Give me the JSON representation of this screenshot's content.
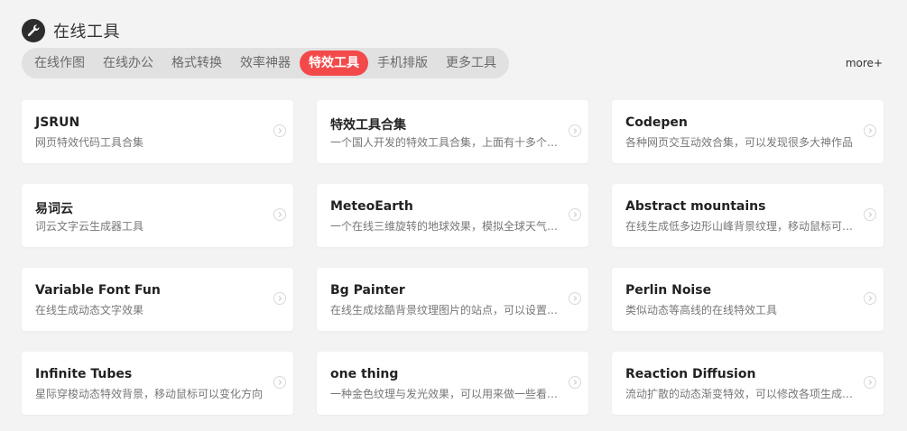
{
  "section": {
    "icon": "wrench-icon",
    "title": "在线工具"
  },
  "tabs": [
    {
      "label": "在线作图",
      "active": false
    },
    {
      "label": "在线办公",
      "active": false
    },
    {
      "label": "格式转换",
      "active": false
    },
    {
      "label": "效率神器",
      "active": false
    },
    {
      "label": "特效工具",
      "active": true
    },
    {
      "label": "手机排版",
      "active": false
    },
    {
      "label": "更多工具",
      "active": false
    }
  ],
  "more_label": "more+",
  "colors": {
    "accent": "#f4494a",
    "background": "#f3f3f4",
    "card": "#ffffff"
  },
  "cards": [
    {
      "title": "JSRUN",
      "desc": "网页特效代码工具合集"
    },
    {
      "title": "特效工具合集",
      "desc": "一个国人开发的特效工具合集，上面有十多个特效工具"
    },
    {
      "title": "Codepen",
      "desc": "各种网页交互动效合集，可以发现很多大神作品"
    },
    {
      "title": "易词云",
      "desc": "词云文字云生成器工具"
    },
    {
      "title": "MeteoEarth",
      "desc": "一个在线三维旋转的地球效果，模拟全球天气预报"
    },
    {
      "title": "Abstract mountains",
      "desc": "在线生成低多边形山峰背景纹理，移动鼠标可以调整"
    },
    {
      "title": "Variable Font Fun",
      "desc": "在线生成动态文字效果"
    },
    {
      "title": "Bg Painter",
      "desc": "在线生成炫酷背景纹理图片的站点，可以设置颜色"
    },
    {
      "title": "Perlin Noise",
      "desc": "类似动态等高线的在线特效工具"
    },
    {
      "title": "Infinite Tubes",
      "desc": "星际穿梭动态特效背景，移动鼠标可以变化方向"
    },
    {
      "title": "one thing",
      "desc": "一种金色纹理与发光效果，可以用来做一些看不懂的背景"
    },
    {
      "title": "Reaction Diffusion",
      "desc": "流动扩散的动态渐变特效，可以修改各项生成参数"
    }
  ]
}
